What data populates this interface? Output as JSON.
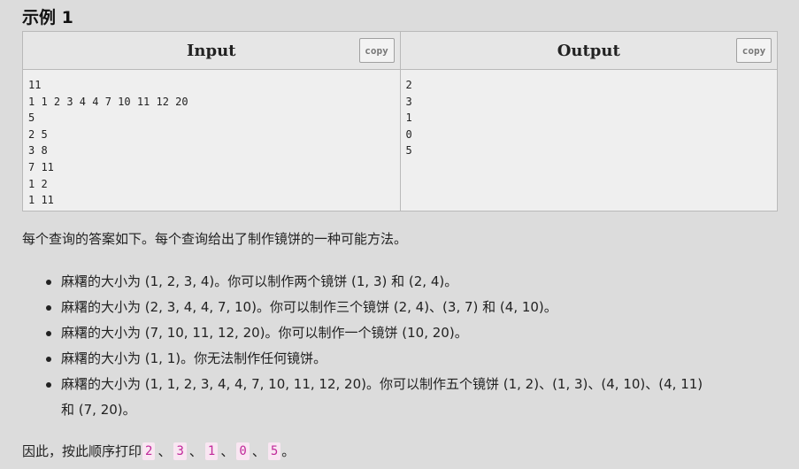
{
  "section_title": "示例 1",
  "sample": {
    "input_header": "Input",
    "output_header": "Output",
    "copy_label": "copy",
    "input_lines": [
      "11",
      "1 1 2 3 4 4 7 10 11 12 20",
      "5",
      "2 5",
      "3 8",
      "7 11",
      "1 2",
      "1 11"
    ],
    "output_lines": [
      "2",
      "3",
      "1",
      "0",
      "5"
    ]
  },
  "note": "每个查询的答案如下。每个查询给出了制作镜饼的一种可能方法。",
  "bullets": [
    "麻糬的大小为 (1, 2, 3, 4)。你可以制作两个镜饼 (1, 3) 和 (2, 4)。",
    "麻糬的大小为 (2, 3, 4, 4, 7, 10)。你可以制作三个镜饼 (2, 4)、(3, 7) 和 (4, 10)。",
    "麻糬的大小为 (7, 10, 11, 12, 20)。你可以制作一个镜饼 (10, 20)。",
    "麻糬的大小为 (1, 1)。你无法制作任何镜饼。",
    "麻糬的大小为 (1, 1, 2, 3, 4, 4, 7, 10, 11, 12, 20)。你可以制作五个镜饼 (1, 2)、(1, 3)、(4, 10)、(4, 11)"
  ],
  "bullet_5_continuation": "和 (7, 20)。",
  "footer": {
    "prefix": "因此，按此顺序打印",
    "values": [
      "2",
      "3",
      "1",
      "0",
      "5"
    ],
    "separator": "、",
    "suffix": "。"
  }
}
